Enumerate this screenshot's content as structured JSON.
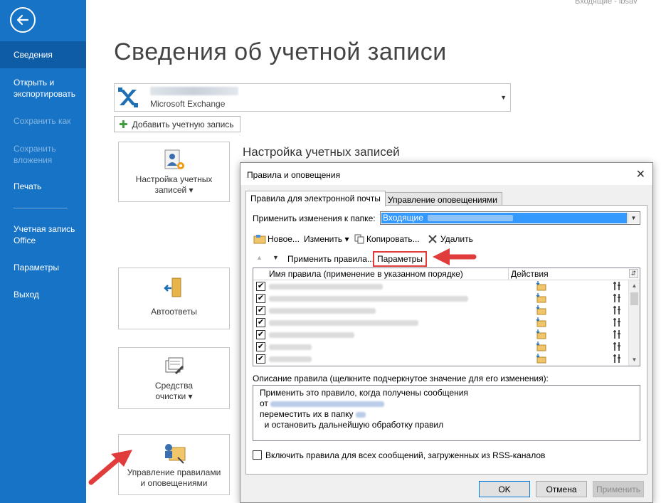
{
  "top_right_text": "Входящие - ibsav",
  "sidebar": {
    "items": [
      {
        "label": "Сведения",
        "active": true
      },
      {
        "label": "Открыть и\nэкспортировать"
      },
      {
        "label": "Сохранить как",
        "disabled": true
      },
      {
        "label": "Сохранить\nвложения",
        "disabled": true
      },
      {
        "label": "Печать"
      },
      {
        "label": "Учетная запись\nOffice"
      },
      {
        "label": "Параметры"
      },
      {
        "label": "Выход"
      }
    ]
  },
  "main": {
    "title": "Сведения об учетной записи",
    "account_type": "Microsoft Exchange",
    "add_account": "Добавить учетную запись",
    "section_title": "Настройка учетных записей",
    "tiles": [
      {
        "label": "Настройка учетных\nзаписей ▾"
      },
      {
        "label": "Автоответы"
      },
      {
        "label": "Средства\nочистки ▾"
      },
      {
        "label": "Управление правилами\nи оповещениями"
      }
    ]
  },
  "dialog": {
    "title": "Правила и оповещения",
    "tabs": [
      "Правила для электронной почты",
      "Управление оповещениями"
    ],
    "apply_to_folder_label": "Применить изменения к папке:",
    "folder_value": "Входящие",
    "toolbar": {
      "new": "Новое...",
      "edit": "Изменить ▾",
      "copy": "Копировать...",
      "delete": "Удалить",
      "apply_rules": "Применить правила...",
      "options": "Параметры"
    },
    "columns": {
      "rule_name": "Имя правила (применение в указанном порядке)",
      "actions": "Действия"
    },
    "rules_checked": [
      true,
      true,
      true,
      true,
      true,
      true,
      true
    ],
    "description_label": "Описание правила (щелкните подчеркнутое значение для его изменения):",
    "description": {
      "line1": "Применить это правило, когда получены сообщения",
      "line2": "от",
      "line3": "переместить их в папку",
      "line4": "  и остановить дальнейшую обработку правил"
    },
    "rss_label": "Включить правила для всех сообщений, загруженных из RSS-каналов",
    "buttons": {
      "ok": "OK",
      "cancel": "Отмена",
      "apply": "Применить"
    }
  },
  "colors": {
    "sidebar": "#1773c6",
    "highlight_box": "#e03c3c",
    "arrow": "#e03c3c"
  }
}
